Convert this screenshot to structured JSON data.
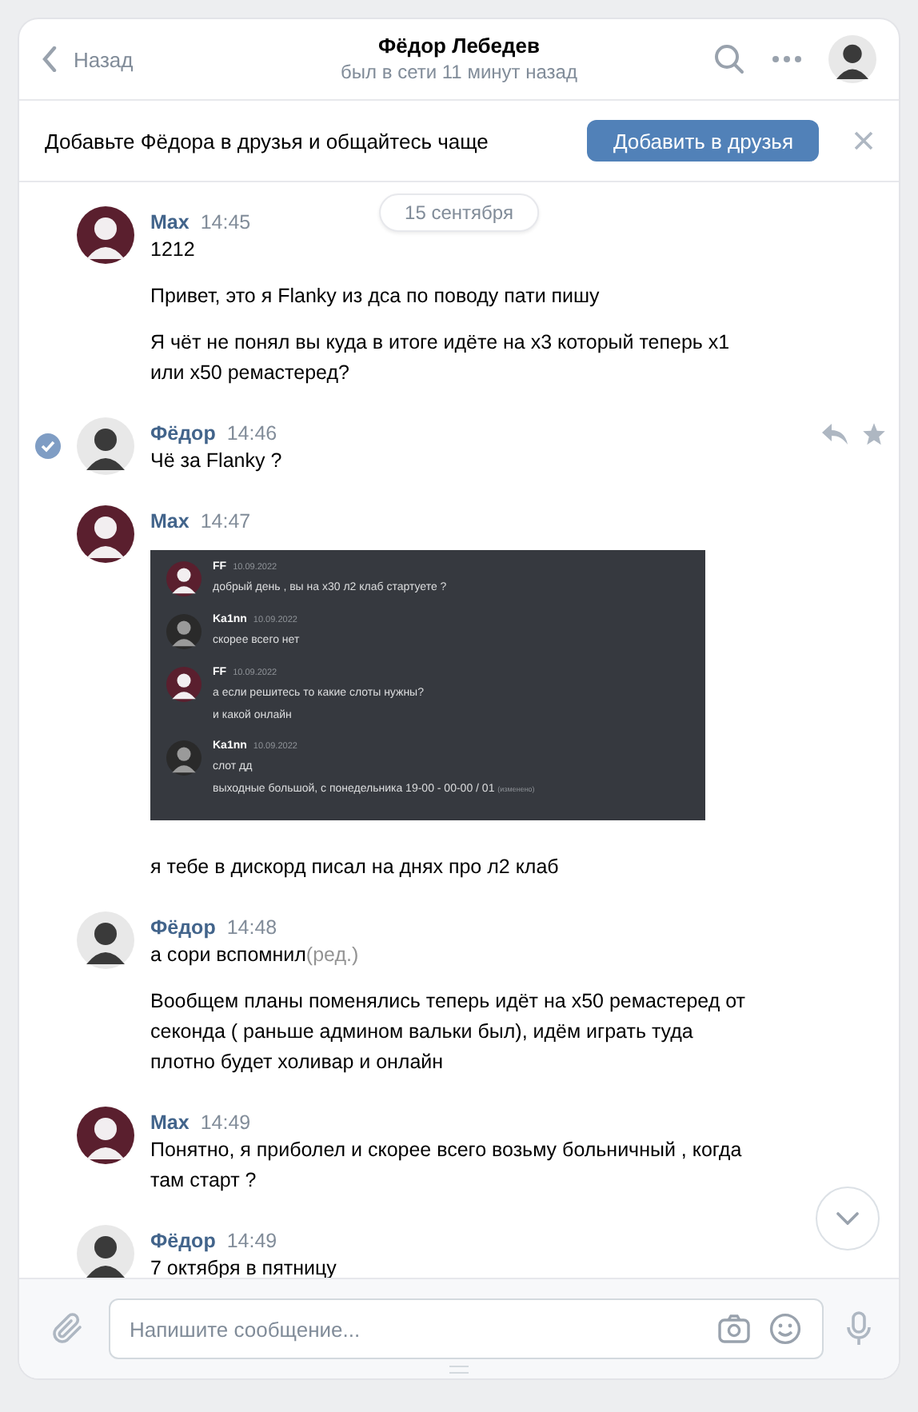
{
  "header": {
    "back": "Назад",
    "title": "Фёдор Лебедев",
    "status": "был в сети 11 минут назад"
  },
  "banner": {
    "text": "Добавьте Фёдора в друзья и общайтесь чаще",
    "button": "Добавить в друзья"
  },
  "date_pill": "15 сентября",
  "messages": [
    {
      "author": "Max",
      "time": "14:45",
      "kind": "light",
      "selected": false,
      "items": [
        {
          "kind": "text",
          "text": "1212"
        },
        {
          "kind": "text",
          "text": "Привет, это я Flanky из дса по поводу пати пишу"
        },
        {
          "kind": "text",
          "text": "Я чёт не понял вы куда в итоге идёте на х3 который теперь х1 или х50 ремастеред?"
        }
      ]
    },
    {
      "author": "Фёдор",
      "time": "14:46",
      "kind": "dark",
      "selected": true,
      "items": [
        {
          "kind": "text",
          "text": "Чё за Flanky ?"
        }
      ]
    },
    {
      "author": "Max",
      "time": "14:47",
      "kind": "light",
      "selected": false,
      "items": [
        {
          "kind": "screenshot",
          "posts": [
            {
              "author": "FF",
              "date": "10.09.2022",
              "kind": "light",
              "lines": [
                "добрый день , вы на х30 л2 клаб стартуете ?"
              ]
            },
            {
              "author": "Ka1nn",
              "date": "10.09.2022",
              "kind": "grey",
              "lines": [
                "скорее всего нет"
              ]
            },
            {
              "author": "FF",
              "date": "10.09.2022",
              "kind": "light",
              "lines": [
                "а если решитесь то какие слоты нужны?",
                "и какой онлайн"
              ]
            },
            {
              "author": "Ka1nn",
              "date": "10.09.2022",
              "kind": "grey",
              "lines": [
                "слот дд",
                "выходные большой, с понедельника 19-00 - 00-00 / 01"
              ],
              "edited": "(изменено)"
            }
          ]
        },
        {
          "kind": "text",
          "text": "я тебе в дискорд писал на днях про л2 клаб"
        }
      ]
    },
    {
      "author": "Фёдор",
      "time": "14:48",
      "kind": "dark",
      "selected": false,
      "items": [
        {
          "kind": "text",
          "text": "а сори вспомнил",
          "edited": "(ред.)"
        },
        {
          "kind": "text",
          "text": "Вообщем планы поменялись теперь идёт на х50 ремастеред от секонда ( раньше админом вальки был), идём играть туда плотно будет холивар и онлайн"
        }
      ]
    },
    {
      "author": "Max",
      "time": "14:49",
      "kind": "light",
      "selected": false,
      "items": [
        {
          "kind": "text",
          "text": "Понятно, я приболел и скорее всего возьму больничный , когда там старт ?"
        }
      ]
    },
    {
      "author": "Фёдор",
      "time": "14:49",
      "kind": "dark",
      "selected": false,
      "items": [
        {
          "kind": "text",
          "text": "7 октября в пятницу"
        }
      ]
    }
  ],
  "composer": {
    "placeholder": "Напишите сообщение..."
  }
}
